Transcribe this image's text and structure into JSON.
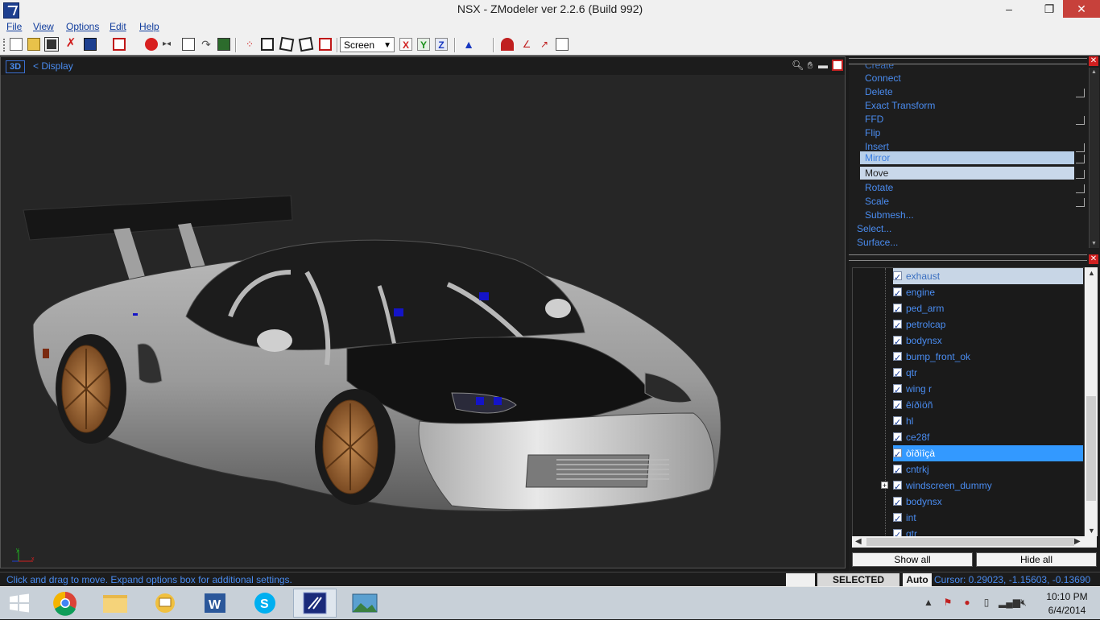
{
  "window": {
    "title": "NSX - ZModeler ver 2.2.6 (Build 992)",
    "minimize": "–",
    "restore": "❐",
    "close": "✕"
  },
  "menu": [
    "File",
    "View",
    "Options",
    "Edit",
    "Help"
  ],
  "toolbar": {
    "coord_mode": "Screen",
    "axis_x": "X",
    "axis_y": "Y",
    "axis_z": "Z"
  },
  "viewport": {
    "mode": "3D",
    "breadcrumb": "<  Display"
  },
  "commands": {
    "items": [
      {
        "label": "Create",
        "has_options": false,
        "state": "cut"
      },
      {
        "label": "Connect",
        "has_options": false,
        "state": "normal"
      },
      {
        "label": "Delete",
        "has_options": true,
        "state": "normal"
      },
      {
        "label": "Exact Transform",
        "has_options": false,
        "state": "normal"
      },
      {
        "label": "FFD",
        "has_options": true,
        "state": "normal"
      },
      {
        "label": "Flip",
        "has_options": false,
        "state": "normal"
      },
      {
        "label": "Insert",
        "has_options": true,
        "state": "normal"
      },
      {
        "label": "Mirror",
        "has_options": true,
        "state": "highlight"
      },
      {
        "label": "Move",
        "has_options": true,
        "state": "active"
      },
      {
        "label": "Rotate",
        "has_options": true,
        "state": "normal"
      },
      {
        "label": "Scale",
        "has_options": true,
        "state": "normal"
      },
      {
        "label": "Submesh...",
        "has_options": false,
        "state": "normal"
      }
    ],
    "parents": [
      "Select...",
      "Surface..."
    ]
  },
  "tree": {
    "items": [
      {
        "label": "exhaust",
        "state": "light"
      },
      {
        "label": "engine",
        "state": "normal"
      },
      {
        "label": "ped_arm",
        "state": "normal"
      },
      {
        "label": "petrolcap",
        "state": "normal"
      },
      {
        "label": "bodynsx",
        "state": "normal"
      },
      {
        "label": "bump_front_ok",
        "state": "normal"
      },
      {
        "label": "qtr",
        "state": "normal"
      },
      {
        "label": "wing r",
        "state": "normal"
      },
      {
        "label": "êíðìöñ",
        "state": "normal"
      },
      {
        "label": "hl",
        "state": "normal"
      },
      {
        "label": "ce28f",
        "state": "normal"
      },
      {
        "label": "òîðìîçà",
        "state": "blue"
      },
      {
        "label": "cntrkj",
        "state": "normal"
      },
      {
        "label": "windscreen_dummy",
        "state": "expand"
      },
      {
        "label": "bodynsx",
        "state": "normal"
      },
      {
        "label": "int",
        "state": "normal"
      },
      {
        "label": "qtr",
        "state": "cut"
      }
    ],
    "show_all": "Show all",
    "hide_all": "Hide all"
  },
  "statusbar": {
    "hint": "Click and drag to move. Expand options box for additional settings.",
    "selected_mode": "SELECTED MODE",
    "auto": "Auto",
    "cursor": "Cursor: 0.29023, -1.15603, -0.13690"
  },
  "taskbar": {
    "apps": [
      "chrome-icon",
      "file-explorer-icon",
      "outlook-icon",
      "word-icon",
      "skype-icon",
      "asus-icon",
      "photos-icon"
    ],
    "time": "10:10 PM",
    "date": "6/4/2014"
  },
  "colors": {
    "accent": "#4a8cf0",
    "selection": "#3399ff",
    "viewport_bg": "#262626"
  }
}
